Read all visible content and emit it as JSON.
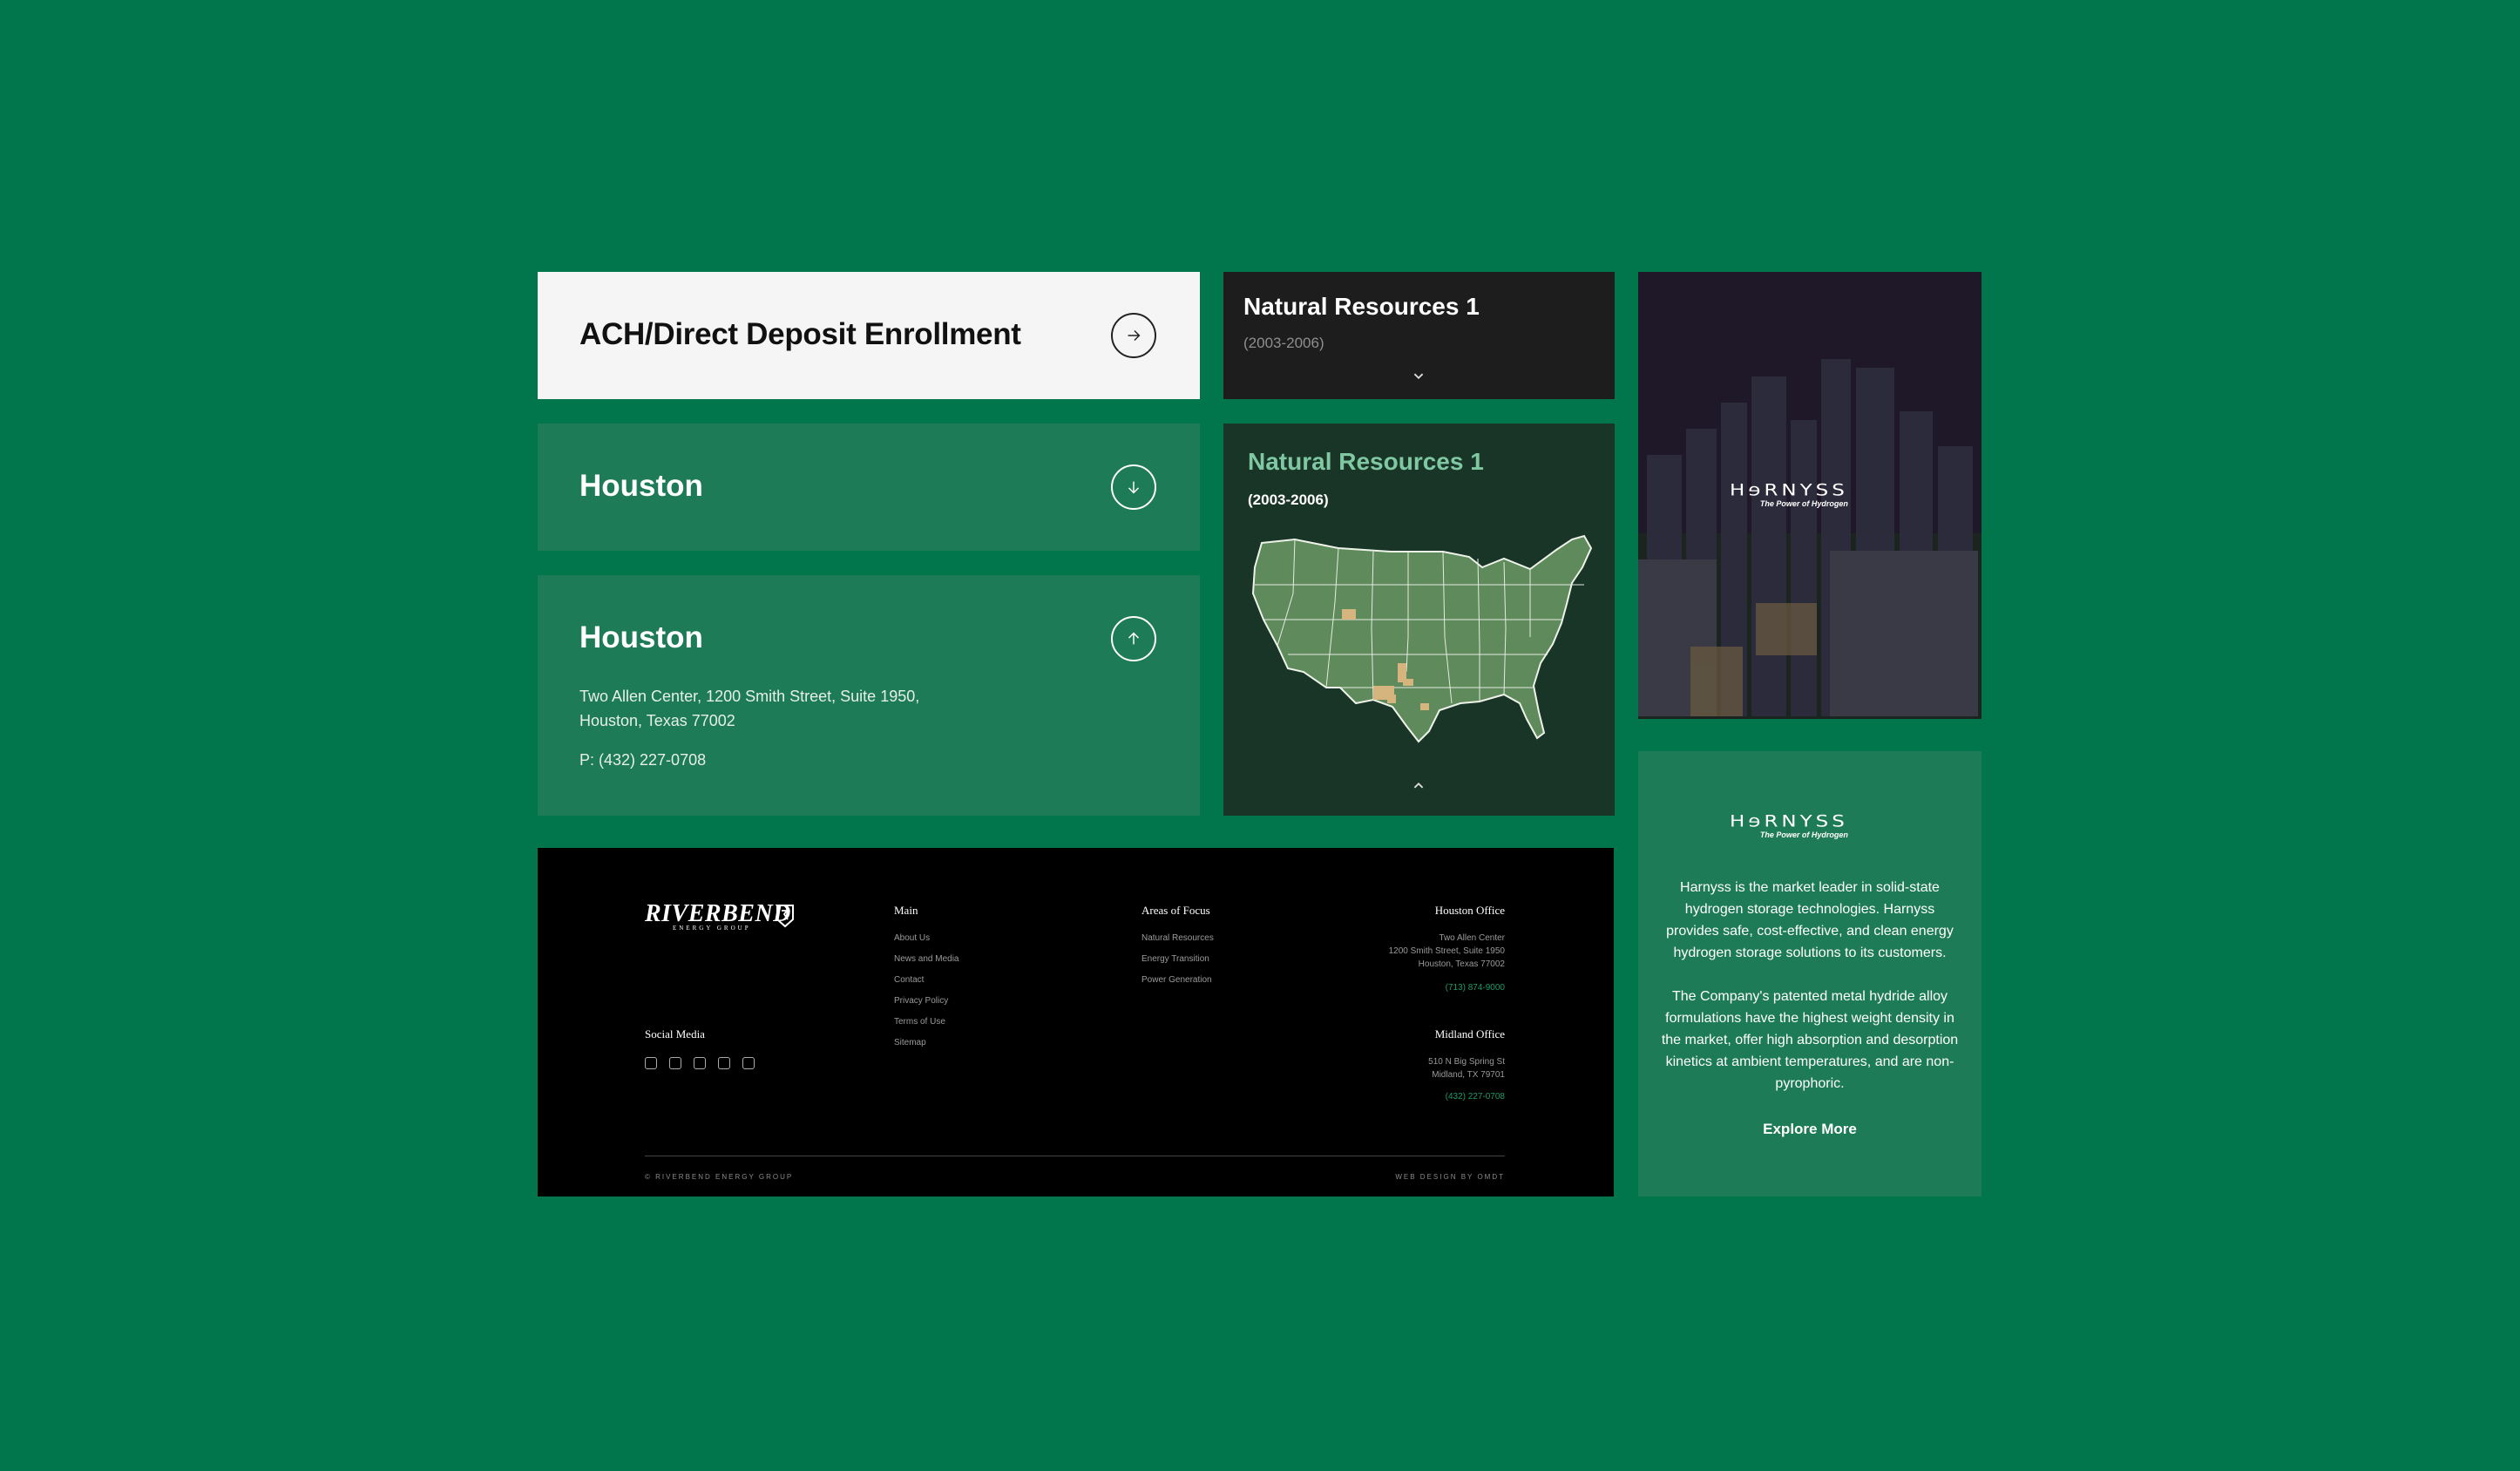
{
  "ach": {
    "title": "ACH/Direct Deposit Enrollment"
  },
  "houston_collapsed": {
    "title": "Houston"
  },
  "houston_expanded": {
    "title": "Houston",
    "address_line1": "Two Allen Center, 1200 Smith Street, Suite 1950,",
    "address_line2": "Houston, Texas 77002",
    "phone": "P: (432) 227-0708"
  },
  "natural_resources_collapsed": {
    "title": "Natural Resources 1",
    "years": "(2003-2006)"
  },
  "natural_resources_expanded": {
    "title": "Natural Resources 1",
    "years": "(2003-2006)"
  },
  "harnyss": {
    "logo_text": "HɘRNYSS",
    "tagline": "The Power of Hydrogen",
    "paragraph1": "Harnyss is the market leader in solid-state hydrogen storage technologies. Harnyss provides safe, cost-effective, and clean energy hydrogen storage solutions to its customers.",
    "paragraph2": "The Company's patented metal hydride alloy formulations have the highest weight density in the market, offer high absorption and desorption kinetics at ambient temperatures, and are non-pyrophoric.",
    "cta": "Explore More"
  },
  "footer": {
    "brand_name": "RIVERBEND",
    "brand_sub": "ENERGY GROUP",
    "social_heading": "Social Media",
    "social_icons": [
      "instagram-icon",
      "youtube-icon",
      "x-icon",
      "linkedin-icon",
      "facebook-icon"
    ],
    "main": {
      "heading": "Main",
      "links": [
        "About Us",
        "News and Media",
        "Contact",
        "Privacy Policy",
        "Terms of Use",
        "Sitemap"
      ]
    },
    "areas": {
      "heading": "Areas of Focus",
      "links": [
        "Natural Resources",
        "Energy Transition",
        "Power Generation"
      ]
    },
    "houston_office": {
      "heading": "Houston Office",
      "line1": "Two Allen Center",
      "line2": "1200 Smith Street, Suite 1950",
      "line3": "Houston, Texas 77002",
      "phone": "(713) 874-9000"
    },
    "midland_office": {
      "heading": "Midland Office",
      "line1": "510 N Big Spring St",
      "line2": "Midland, TX 79701",
      "phone": "(432) 227-0708"
    },
    "copyright": "© RIVERBEND ENERGY GROUP",
    "credit": "WEB DESIGN BY OMDT"
  },
  "colors": {
    "page_bg": "#01764c",
    "card_green": "#1d7b57",
    "map_card_bg": "#193528",
    "accent_green": "#7fc8a2",
    "phone_green": "#1e9a68",
    "highlight_tan": "#d6b47d"
  }
}
